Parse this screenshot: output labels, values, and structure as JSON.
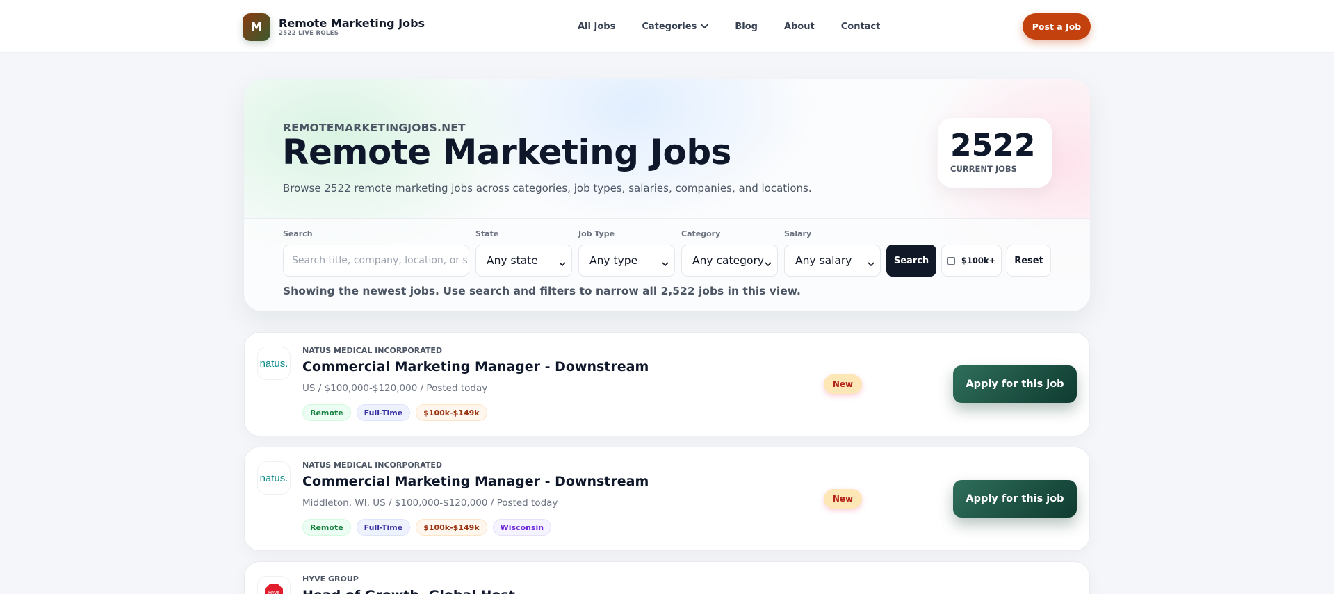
{
  "header": {
    "logo_letter": "M",
    "brand_name": "Remote Marketing Jobs",
    "brand_sub": "2522 LIVE ROLES",
    "nav": [
      "All Jobs",
      "Categories",
      "Blog",
      "About",
      "Contact"
    ],
    "post_button": "Post a Job"
  },
  "hero": {
    "eyebrow": "REMOTEMARKETINGJOBS.NET",
    "title": "Remote Marketing Jobs",
    "description": "Browse 2522 remote marketing jobs across categories, job types, salaries, companies, and locations.",
    "count": "2522",
    "count_label": "CURRENT JOBS"
  },
  "filters": {
    "search_label": "Search",
    "search_placeholder": "Search title, company, location, or s",
    "state_label": "State",
    "state_value": "Any state",
    "type_label": "Job Type",
    "type_value": "Any type",
    "category_label": "Category",
    "category_value": "Any category",
    "salary_label": "Salary",
    "salary_value": "Any salary",
    "search_button": "Search",
    "high_salary_label": "$100k+",
    "reset_button": "Reset",
    "hint": "Showing the newest jobs. Use search and filters to narrow all 2,522 jobs in this view."
  },
  "jobs": [
    {
      "logo_text": "natus.",
      "company": "NATUS MEDICAL INCORPORATED",
      "title": "Commercial Marketing Manager - Downstream",
      "meta": "US  /  $100,000-$120,000  /  Posted today",
      "tags": [
        "Remote",
        "Full-Time",
        "$100k-$149k"
      ],
      "badge": "New",
      "apply": "Apply for this job"
    },
    {
      "logo_text": "natus.",
      "company": "NATUS MEDICAL INCORPORATED",
      "title": "Commercial Marketing Manager - Downstream",
      "meta": "Middleton, WI, US  /  $100,000-$120,000  /  Posted today",
      "tags": [
        "Remote",
        "Full-Time",
        "$100k-$149k",
        "Wisconsin"
      ],
      "badge": "New",
      "apply": "Apply for this job"
    },
    {
      "logo_text": "Hyve",
      "company": "HYVE GROUP",
      "title": "Head of Growth, Global Host",
      "meta": "",
      "tags": [],
      "badge": "",
      "apply": ""
    }
  ],
  "colors": {
    "accent": "#c2410c",
    "dark": "#111827",
    "apply_green": "#1f5a49"
  }
}
